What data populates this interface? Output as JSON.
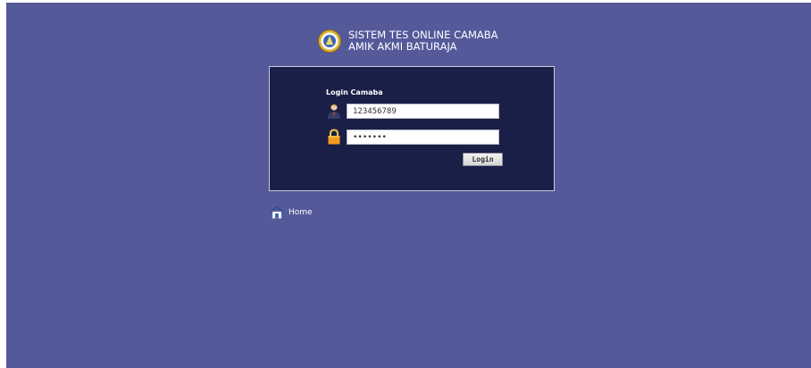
{
  "app": {
    "title_line1": "SISTEM TES ONLINE CAMABA",
    "title_line2": "AMIK AKMI BATURAJA"
  },
  "login": {
    "heading": "Login Camaba",
    "username_value": "123456789",
    "password_value": "1234567",
    "button_label": "Login"
  },
  "nav": {
    "home_label": "Home"
  },
  "icons": {
    "logo": "campus-seal-icon",
    "user": "user-icon",
    "password": "lock-icon",
    "home": "home-icon"
  },
  "colors": {
    "background": "#54599a",
    "login_panel": "#1a1f48"
  }
}
